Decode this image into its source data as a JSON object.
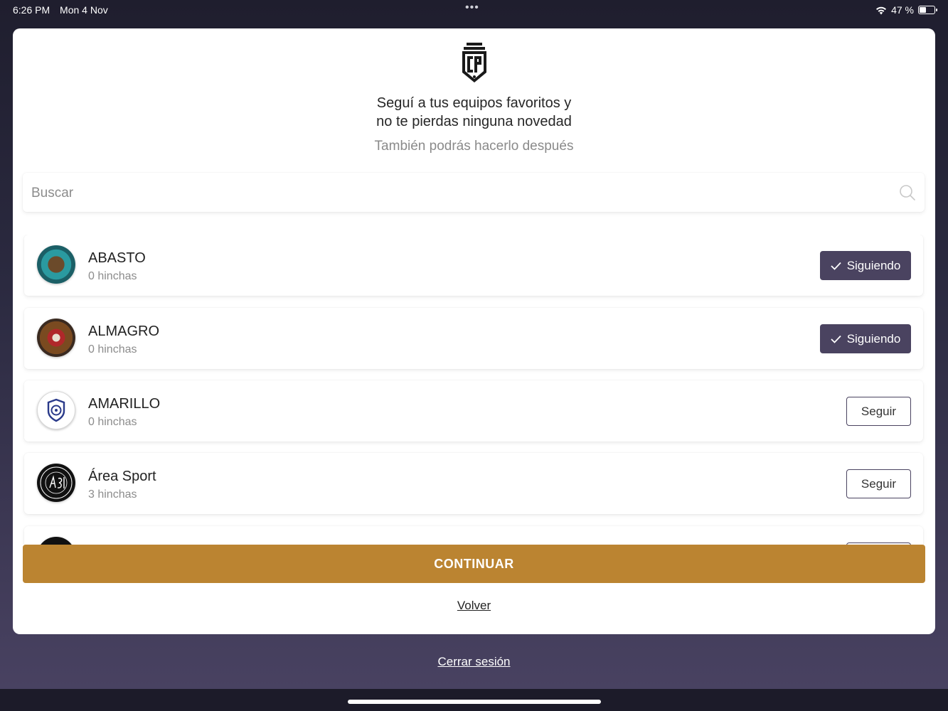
{
  "status_bar": {
    "time": "6:26 PM",
    "date": "Mon 4 Nov",
    "battery": "47 %",
    "battery_level": 0.47,
    "dots": "•••"
  },
  "header": {
    "logo_text": "COPA POTRERO",
    "headline_line1": "Seguí a tus equipos favoritos y",
    "headline_line2": "no te pierdas ninguna novedad",
    "subtitle": "También podrás hacerlo después"
  },
  "search": {
    "placeholder": "Buscar",
    "value": ""
  },
  "teams": [
    {
      "name": "ABASTO",
      "fans": "0 hinchas",
      "button": "Siguiendo",
      "following": true
    },
    {
      "name": "ALMAGRO",
      "fans": "0 hinchas",
      "button": "Siguiendo",
      "following": true
    },
    {
      "name": "AMARILLO",
      "fans": "0 hinchas",
      "button": "Seguir",
      "following": false
    },
    {
      "name": "Área Sport",
      "fans": "3 hinchas",
      "button": "Seguir",
      "following": false
    },
    {
      "name": "",
      "fans": "",
      "button": "",
      "following": false
    }
  ],
  "actions": {
    "continue": "CONTINUAR",
    "back": "Volver",
    "logout": "Cerrar sesión"
  },
  "colors": {
    "accent": "#bb8431",
    "following_bg": "#4a4360",
    "background": "#2b2a40"
  }
}
